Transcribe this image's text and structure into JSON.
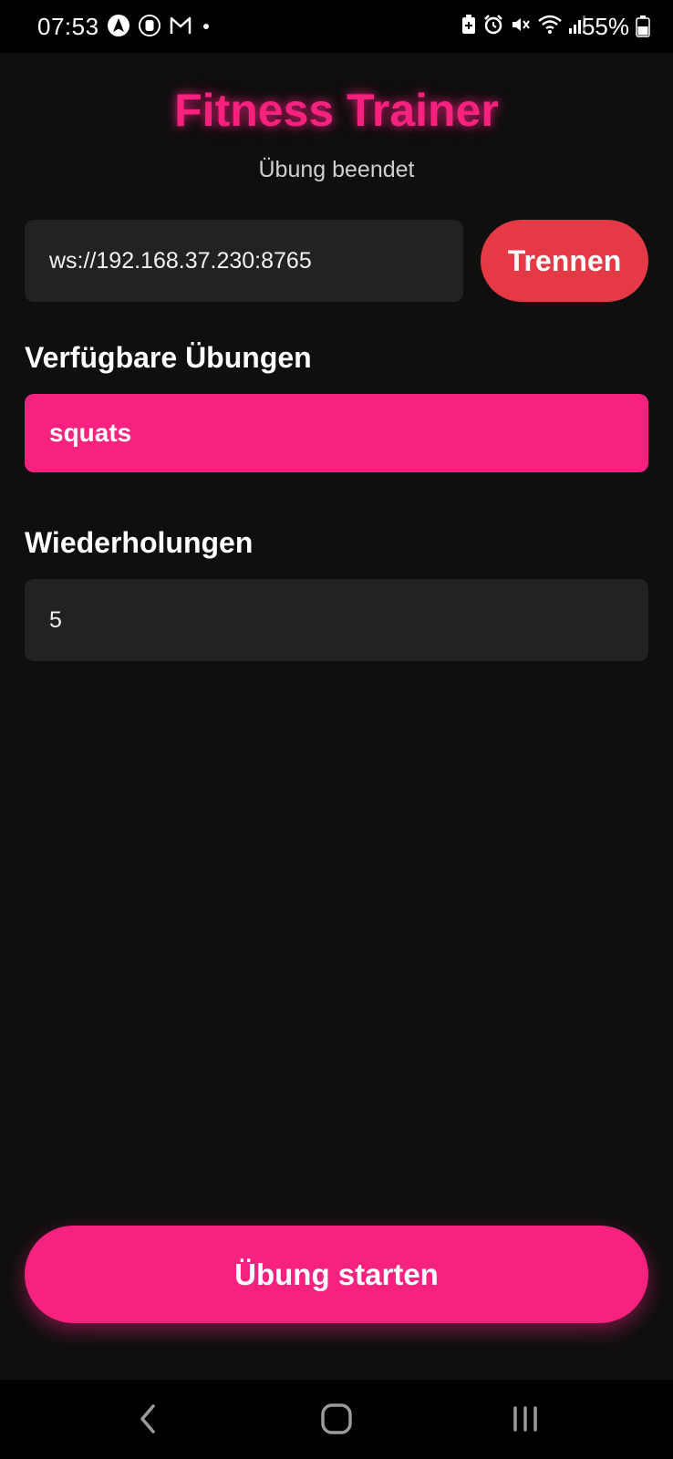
{
  "status_bar": {
    "time": "07:53",
    "battery_percent": "55%",
    "left_icons": [
      "navigation-app-icon",
      "notification-app-icon",
      "gmail-icon",
      "more-notifications-dot-icon"
    ],
    "right_icons": [
      "battery-saver-icon",
      "alarm-icon",
      "vibrate-mute-icon",
      "wifi-icon",
      "signal-icon",
      "battery-icon"
    ]
  },
  "header": {
    "title": "Fitness Trainer",
    "status": "Übung beendet"
  },
  "connection": {
    "server_url": "ws://192.168.37.230:8765",
    "disconnect_label": "Trennen"
  },
  "exercises": {
    "label": "Verfügbare Übungen",
    "items": [
      "squats"
    ],
    "selected": "squats"
  },
  "repetitions": {
    "label": "Wiederholungen",
    "value": "5"
  },
  "actions": {
    "start_label": "Übung starten"
  },
  "navigation": {
    "buttons": [
      "back-icon",
      "home-icon",
      "recent-apps-icon"
    ]
  },
  "colors": {
    "accent": "#f7227f",
    "danger": "#e63946",
    "background": "#0f0f0f",
    "input_background": "#222222"
  }
}
